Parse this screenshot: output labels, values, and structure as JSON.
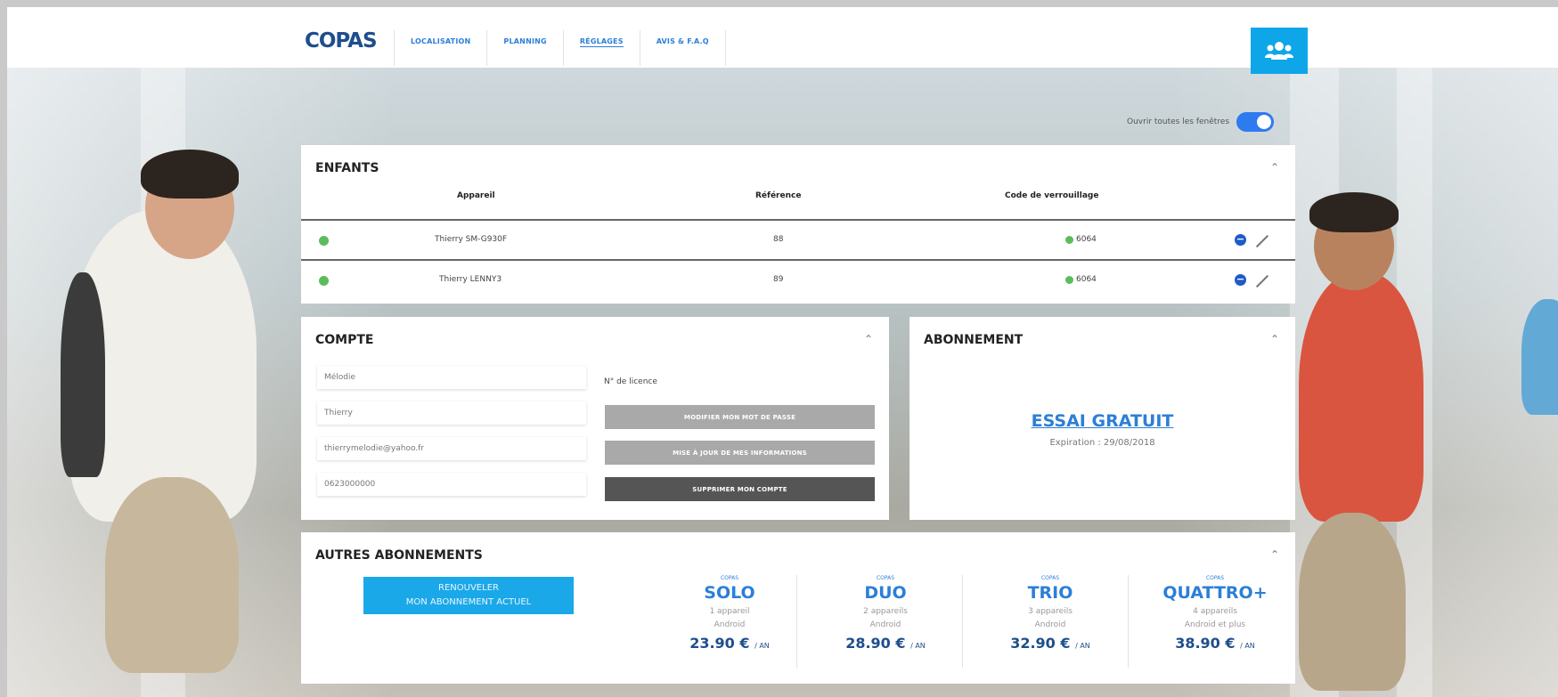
{
  "header": {
    "logo": "COPAS",
    "nav": [
      "LOCALISATION",
      "PLANNING",
      "RÉGLAGES",
      "AVIS & F.A.Q"
    ],
    "active_nav": "RÉGLAGES"
  },
  "toggle": {
    "label": "Ouvrir toutes les fenêtres",
    "state": "on"
  },
  "enfants": {
    "title": "ENFANTS",
    "columns": [
      "Appareil",
      "Référence",
      "Code de verrouillage"
    ],
    "rows": [
      {
        "status": "online",
        "device": "Thierry SM-G930F",
        "reference": "88",
        "code": "6064"
      },
      {
        "status": "online",
        "device": "Thierry LENNY3",
        "reference": "89",
        "code": "6064"
      }
    ]
  },
  "compte": {
    "title": "COMPTE",
    "fields": [
      "Mélodie",
      "Thierry",
      "thierrymelodie@yahoo.fr",
      "0623000000"
    ],
    "licence": "N° de licence",
    "buttons": [
      "MODIFIER MON MOT DE PASSE",
      "MISE À JOUR DE MES INFORMATIONS",
      "SUPPRIMER MON COMPTE"
    ]
  },
  "abonnement": {
    "title": "ABONNEMENT",
    "plan": "ESSAI GRATUIT",
    "expiration": "Expiration : 29/08/2018"
  },
  "autres": {
    "title": "AUTRES ABONNEMENTS",
    "renew_line1": "RENOUVELER",
    "renew_line2": "MON ABONNEMENT ACTUEL",
    "plans": [
      {
        "brand": "COPAS",
        "name": "SOLO",
        "line1": "1 appareil",
        "line2": "Android",
        "price": "23.90 €",
        "unit": "/ AN"
      },
      {
        "brand": "COPAS",
        "name": "DUO",
        "line1": "2 appareils",
        "line2": "Android",
        "price": "28.90 €",
        "unit": "/ AN"
      },
      {
        "brand": "COPAS",
        "name": "TRIO",
        "line1": "3 appareils",
        "line2": "Android",
        "price": "32.90 €",
        "unit": "/ AN"
      },
      {
        "brand": "COPAS",
        "name": "QUATTRO+",
        "line1": "4 appareils",
        "line2": "Android et plus",
        "price": "38.90 €",
        "unit": "/ AN"
      }
    ]
  },
  "colors": {
    "accent": "#2c7fd6",
    "brand_dark": "#1e4e8c",
    "cyan": "#1ba8e8",
    "toggle": "#2e7bf0",
    "online": "#5cbc5c"
  }
}
